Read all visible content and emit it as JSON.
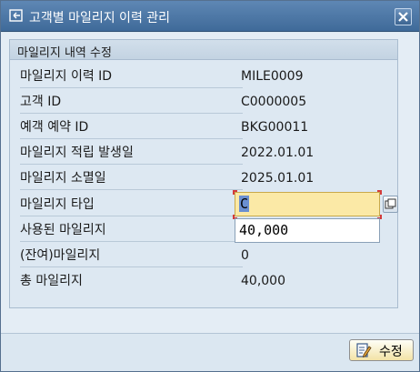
{
  "window": {
    "title": "고객별 마일리지 이력 관리",
    "colors": {
      "titlebar": "#4a76a6",
      "panel": "#dde8f2",
      "highlight_field": "#fbe9a6"
    }
  },
  "group": {
    "title": "마일리지 내역 수정",
    "rows": [
      {
        "label": "마일리지 이력 ID",
        "value": "MILE0009"
      },
      {
        "label": "고객 ID",
        "value": "C0000005"
      },
      {
        "label": "예객 예약 ID",
        "value": "BKG00011"
      },
      {
        "label": "마일리지 적립 발생일",
        "value": "2022.01.01"
      },
      {
        "label": "마일리지 소멸일",
        "value": "2025.01.01"
      },
      {
        "label": "마일리지 타입",
        "value": "C"
      },
      {
        "label": "사용된 마일리지",
        "value": "40,000"
      },
      {
        "label": "(잔여)마일리지",
        "value": "0"
      },
      {
        "label": "총 마일리지",
        "value": "40,000"
      }
    ]
  },
  "footer": {
    "save_label": "수정",
    "save_icon": "edit-icon"
  },
  "icons": {
    "title": "window-return-icon",
    "close": "close-icon",
    "value_help": "value-help-icon"
  }
}
